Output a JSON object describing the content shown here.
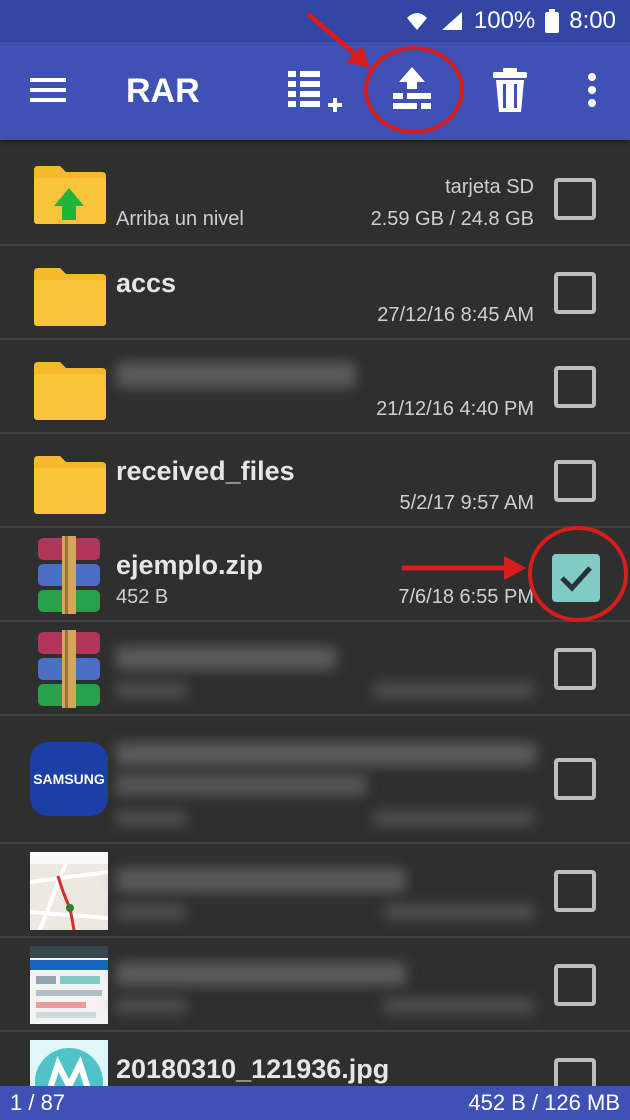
{
  "status_bar": {
    "battery": "100%",
    "time": "8:00",
    "icons": [
      "wifi-icon",
      "signal-icon",
      "battery-icon"
    ]
  },
  "app_bar": {
    "title": "RAR",
    "icons": [
      "menu-icon",
      "add-to-archive-icon",
      "extract-icon",
      "delete-icon",
      "more-icon"
    ]
  },
  "rows": [
    {
      "name": "",
      "left_sub": "Arriba un nivel",
      "right_top": "tarjeta SD",
      "right_bottom": "2.59 GB / 24.8 GB",
      "checked": false,
      "icon": "folder-up-icon"
    },
    {
      "name": "accs",
      "left_sub": "",
      "right_top": "",
      "right_bottom": "27/12/16 8:45 AM",
      "checked": false,
      "icon": "folder-icon"
    },
    {
      "name": "",
      "left_sub": "",
      "right_top": "",
      "right_bottom": "21/12/16 4:40 PM",
      "checked": false,
      "icon": "folder-icon"
    },
    {
      "name": "received_files",
      "left_sub": "",
      "right_top": "",
      "right_bottom": "5/2/17 9:57 AM",
      "checked": false,
      "icon": "folder-icon"
    },
    {
      "name": "ejemplo.zip",
      "left_sub": "452 B",
      "right_top": "",
      "right_bottom": "7/6/18 6:55 PM",
      "checked": true,
      "icon": "archive-icon"
    },
    {
      "name": "",
      "left_sub": "",
      "right_top": "",
      "right_bottom": "",
      "checked": false,
      "icon": "archive-icon"
    },
    {
      "name": "",
      "left_sub": "",
      "right_top": "",
      "right_bottom": "",
      "checked": false,
      "icon": "samsung-logo-icon"
    },
    {
      "name": "",
      "left_sub": "",
      "right_top": "",
      "right_bottom": "",
      "checked": false,
      "icon": "map-thumbnail-icon"
    },
    {
      "name": "",
      "left_sub": "",
      "right_top": "",
      "right_bottom": "",
      "checked": false,
      "icon": "screenshot-thumbnail-icon"
    },
    {
      "name": "20180310_121936.jpg",
      "left_sub": "",
      "right_top": "",
      "right_bottom": "",
      "checked": false,
      "icon": "motorola-logo-icon"
    }
  ],
  "samsung_logo_text": "SAMSUNG",
  "bottom_bar": {
    "position": "1 / 87",
    "size": "452 B / 126 MB"
  },
  "colors": {
    "app_bar": "#3f51b5",
    "status_bar": "#3346a6",
    "background": "#2f2f2f",
    "folder": "#f6b92b",
    "check": "#80cbc4",
    "annotation": "#d91c1c"
  }
}
